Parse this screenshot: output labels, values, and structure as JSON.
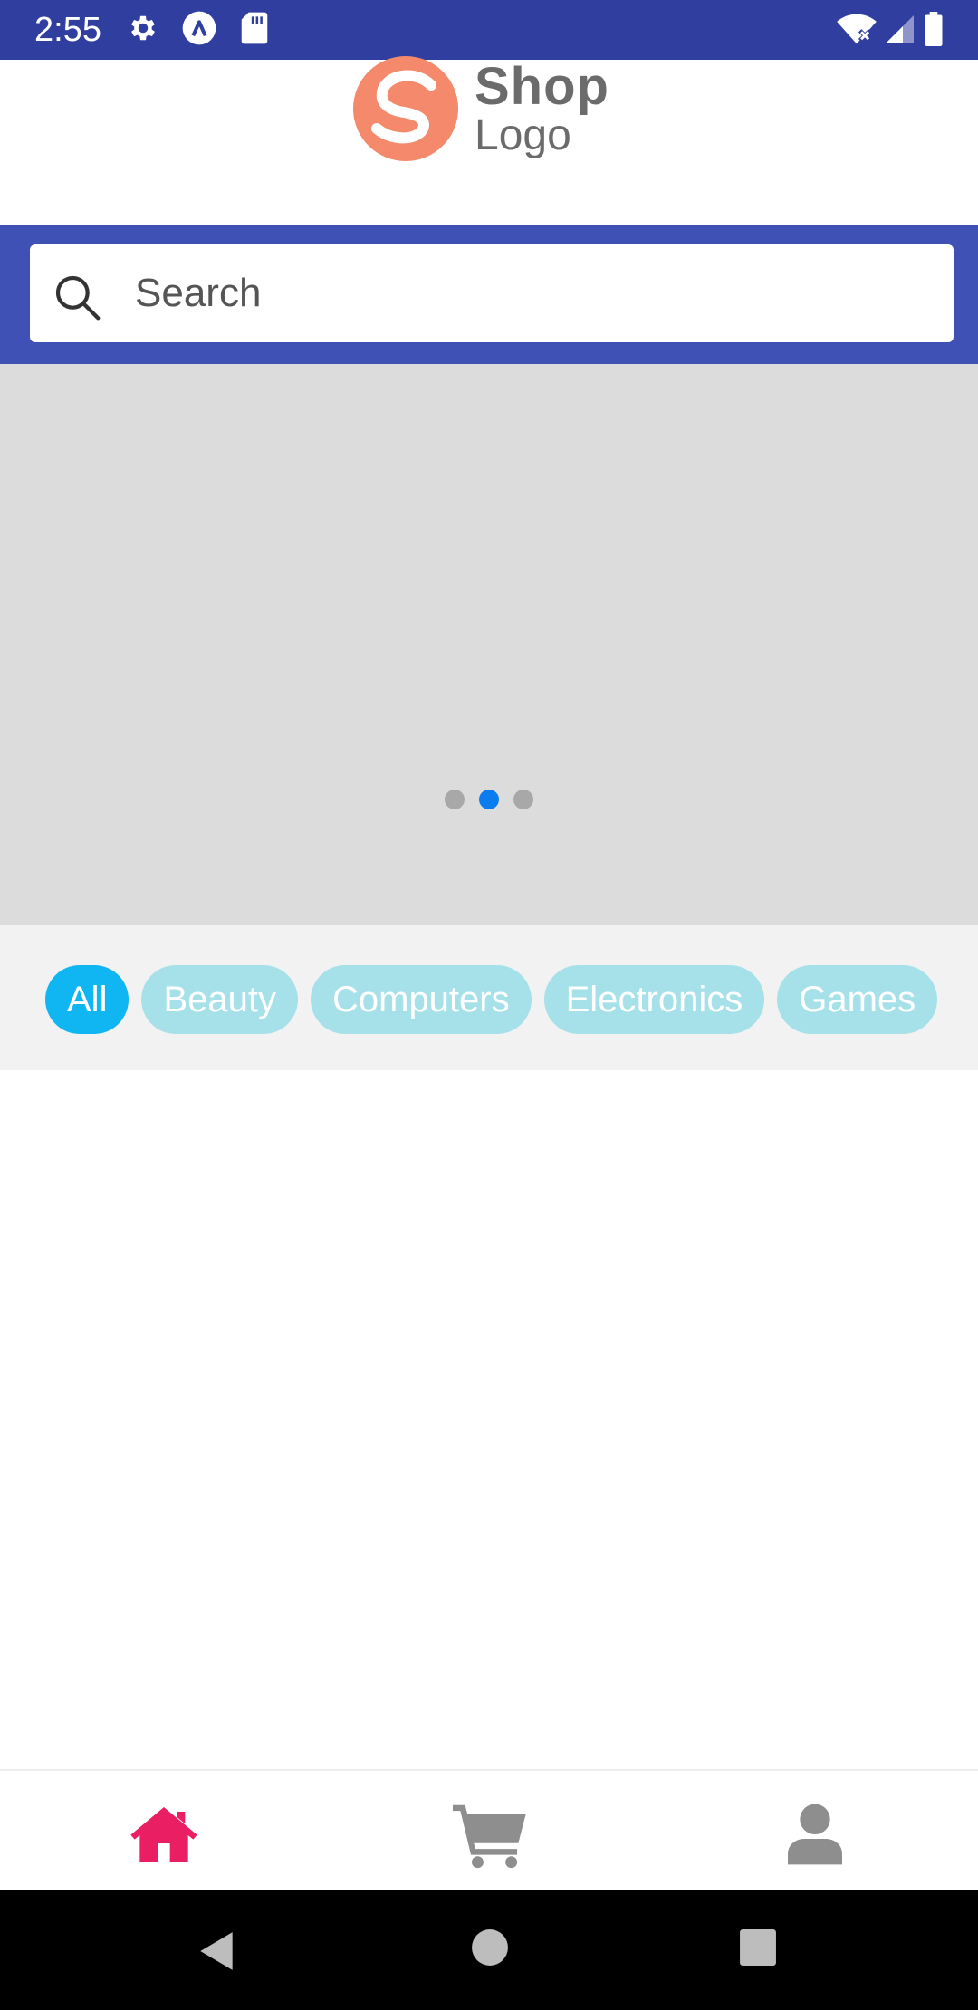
{
  "status_bar": {
    "time": "2:55",
    "background": "#303F9F",
    "icons": [
      "gear-icon",
      "accessibility-icon",
      "sd-card-icon",
      "wifi-icon",
      "signal-icon",
      "battery-icon"
    ]
  },
  "header": {
    "logo": {
      "primary": "Shop",
      "secondary": "Logo",
      "mark_color": "#F4896B"
    }
  },
  "search": {
    "placeholder": "Search",
    "band_color": "#3F51B5"
  },
  "carousel": {
    "slide_count": 3,
    "active_index": 1
  },
  "categories": {
    "items": [
      "All",
      "Beauty",
      "Computers",
      "Electronics",
      "Games"
    ],
    "active": "All",
    "active_color": "#0FB6F2",
    "inactive_color": "#A6E1EA"
  },
  "bottom_nav": {
    "items": [
      "home-icon",
      "cart-icon",
      "user-icon"
    ],
    "active_item": "home-icon",
    "active_color": "#E91E63",
    "inactive_color": "#8E8E8E"
  },
  "system_nav": {
    "buttons": [
      "back-icon",
      "home-circle-icon",
      "recents-icon"
    ]
  }
}
